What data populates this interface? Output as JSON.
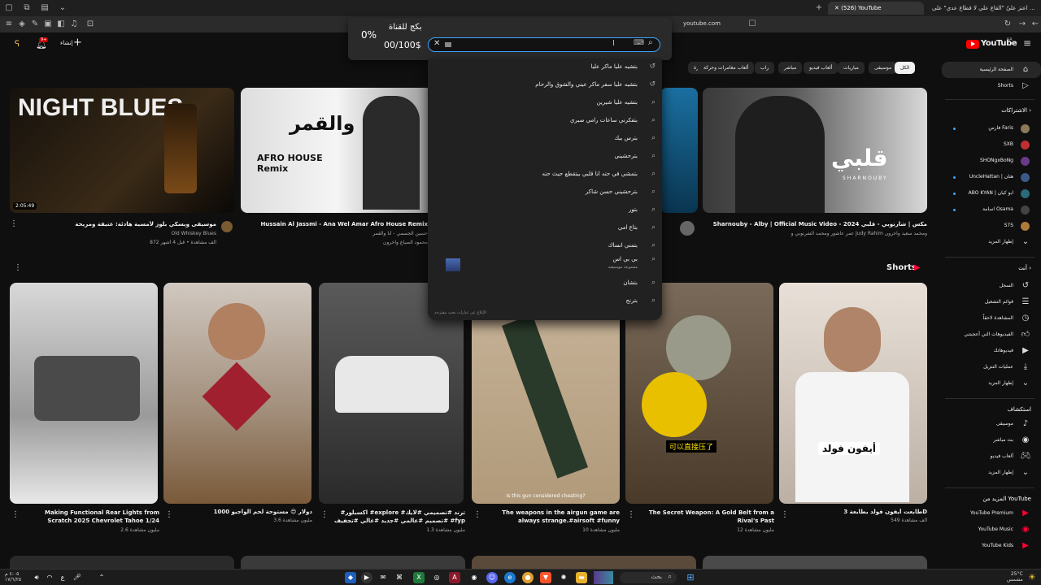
{
  "browser": {
    "tabs": [
      {
        "label": "اعتز عليّ \"القاع علي لا قطاع عدي\" على ..."
      },
      {
        "label": "(526) YouTube"
      }
    ],
    "address": "youtube.com"
  },
  "header": {
    "create_label": "إنشاء",
    "notification_count": "9+",
    "logo_text": "YouTube",
    "logo_region": "SA"
  },
  "overlay": {
    "percent": "0%",
    "title": "بكج للقناة",
    "counter": "00/100$"
  },
  "search": {
    "value": "",
    "suggestions": [
      {
        "text": "بتشيه عليا ماكر عليا",
        "icon": "history-icon"
      },
      {
        "text": "بتشيه عليا سفر ماكر عيني والشوق والرحام",
        "icon": "history-icon"
      },
      {
        "text": "بتشيه عليا شيرين",
        "icon": "search-icon"
      },
      {
        "text": "بتفكرني ساعات رامي صبري",
        "icon": "search-icon"
      },
      {
        "text": "بترس بيك",
        "icon": "search-icon"
      },
      {
        "text": "بترحشيني",
        "icon": "search-icon"
      },
      {
        "text": "بتمشي في حته انا قلبي بيتقطع حيث حته",
        "icon": "search-icon"
      },
      {
        "text": "بترحشيني حسن شاكر",
        "icon": "search-icon"
      },
      {
        "text": "بتور",
        "icon": "search-icon"
      },
      {
        "text": "بتاع امي",
        "icon": "search-icon"
      },
      {
        "text": "بتمني انساك",
        "icon": "search-icon"
      },
      {
        "text": "بي بي اس",
        "sub": "مجموعة موسيقية",
        "icon": "search-icon"
      },
      {
        "text": "بتشان",
        "icon": "search-icon"
      },
      {
        "text": "بترنح",
        "icon": "search-icon"
      }
    ],
    "footer": "الإبلاغ عن عبارات بحث مقترحة"
  },
  "chips": [
    "الكل",
    "موسيقى",
    "مباريات",
    "ألعاب فيديو",
    "مباشر",
    "راب",
    "ألعاب مغامرات وحركة",
    "سيارة"
  ],
  "videos": [
    {
      "title": "موسيقى ويسكي بلوز لأمسية هادئة: عتيقة ومريحة",
      "channel": "Old Whiskey Blues",
      "stats": "872 ألف مشاهدة • قبل 4 أشهر",
      "duration": "2:05:49",
      "thumb_text": "NIGHT BLUES"
    },
    {
      "title": "Hussain Al Jassmi - Ana Wel Amar Afro House Remix",
      "channel": "حسين الجسمي - أنا والقمر",
      "stats": "محمود الصباغ وآخرون",
      "thumb_text": "أنا والقمر",
      "thumb_sub": "AFRO HOUSE Remix"
    },
    {
      "title": "Sharnouby - Alby | Official Music Video - 2024 مكس | شارنوبي - قلبي",
      "channel": "عمر عاشور ومحمد الشرنوبي و Judy Rahim ومحمد سعيد وآخرون",
      "stats": "",
      "thumb_text": "قلبي",
      "thumb_sub": "SHARNOUBY"
    }
  ],
  "shorts_title": "Shorts",
  "shorts": [
    {
      "title": "Making Functional Rear Lights from Scratch 2025 Chevrolet Tahoe 1/24",
      "views": "2.6 مليون مشاهدة"
    },
    {
      "title": "1000 دولار 😍 مستوحة لحم الواجيو",
      "views": "3.6 مليون مشاهدة"
    },
    {
      "title": "#اكسبلور #explore #ترند #تصميمي #لايك #تصميم #عالمي #جديد #غالي #تجفيف #fyp #foryou",
      "views": "1.3 مليون مشاهدة"
    },
    {
      "title": "The weapons in the airgun game are always strange.#airsoft #funny",
      "views": "10 مليون مشاهدة",
      "caption": "Is this gun considered cheating?"
    },
    {
      "title": "The Secret Weapon: A Gold Belt from a Rival's Past",
      "views": "12 مليون مشاهدة",
      "caption": "可以直接压了"
    },
    {
      "title": "طابعت أيفون فولد بطابعة 3D",
      "views": "549 ألف مشاهدة",
      "caption": "أيفون فولد"
    }
  ],
  "sidebar": {
    "home": "الصفحة الرئيسية",
    "shorts": "Shorts",
    "subs_title": "الاشتراكات",
    "subs": [
      "فارس Faris",
      "SXB",
      "SHONgxBoNg",
      "UncleHattan | هتان",
      "ABO KYAN | ابو كيان",
      "اسامة Osama",
      "S7S"
    ],
    "show_more": "إظهار المزيد",
    "you_title": "أنت",
    "you_items": [
      "السجل",
      "قوائم التشغيل",
      "المشاهدة لاحقاً",
      "الفيديوهات التي أعجبتني",
      "فيديوهاتك",
      "عمليات التنزيل",
      "إظهار المزيد"
    ],
    "explore_title": "استكشاف",
    "explore_items": [
      "موسيقى",
      "بث مباشر",
      "ألعاب فيديو",
      "إظهار المزيد"
    ],
    "more_title": "المزيد من YouTube",
    "more_items": [
      "YouTube Premium",
      "YouTube Music",
      "YouTube Kids"
    ]
  },
  "taskbar": {
    "search_placeholder": "بحث",
    "weather": "25°C",
    "weather_sub": "مشمس",
    "time": "٤:٠٥ م",
    "date": "١٧/٦/٢٥"
  }
}
